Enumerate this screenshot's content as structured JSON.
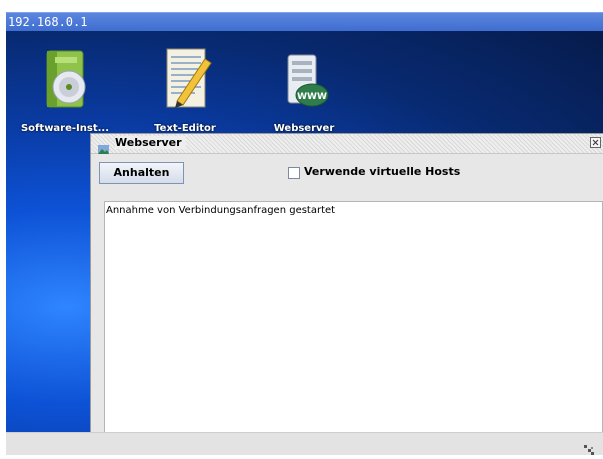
{
  "address_bar": {
    "text": "192.168.0.1"
  },
  "desktop": {
    "icons": [
      {
        "label": "Software-Inst...",
        "icon": "software-installer-icon"
      },
      {
        "label": "Text-Editor",
        "icon": "text-editor-icon"
      },
      {
        "label": "Webserver",
        "icon": "webserver-icon"
      }
    ]
  },
  "window": {
    "title": "Webserver",
    "stop_button": "Anhalten",
    "vhost_checkbox_label": "Verwende virtuelle Hosts",
    "vhost_checked": false,
    "log_text": "Annahme von Verbindungsanfragen gestartet"
  },
  "colors": {
    "address_bar": "#4a78d8",
    "desktop": "#0a3da8",
    "window_bg": "#e7e7e7"
  }
}
